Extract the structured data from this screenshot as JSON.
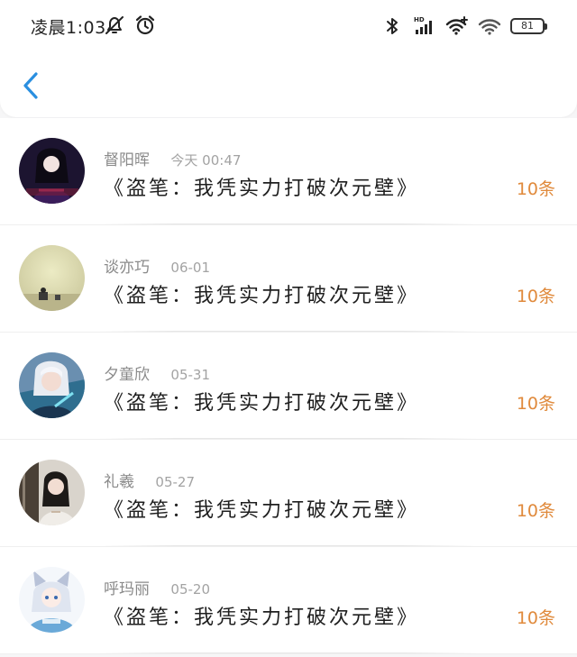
{
  "status_bar": {
    "time": "凌晨1:03",
    "battery": "81",
    "icons": [
      "alarm-off-icon",
      "alarm-clock-icon",
      "bluetooth-icon",
      "hd-signal-icon",
      "wifi-plus-icon",
      "wifi-icon",
      "battery-icon"
    ]
  },
  "nav": {
    "back_icon": "chevron-left-icon"
  },
  "colors": {
    "accent_blue": "#2a8fe0",
    "count_orange": "#e08a3c",
    "name_gray": "#8a8a8a"
  },
  "items": [
    {
      "name": "督阳晖",
      "date": "今天 00:47",
      "title": "《盗笔：我凭实力打破次元壁》",
      "count": "10条",
      "avatar": "avatar-dark-portrait"
    },
    {
      "name": "谈亦巧",
      "date": "06-01",
      "title": "《盗笔：我凭实力打破次元壁》",
      "count": "10条",
      "avatar": "avatar-beige-room"
    },
    {
      "name": "夕童欣",
      "date": "05-31",
      "title": "《盗笔：我凭实力打破次元壁》",
      "count": "10条",
      "avatar": "avatar-anime-white-hair"
    },
    {
      "name": "礼羲",
      "date": "05-27",
      "title": "《盗笔：我凭实力打破次元壁》",
      "count": "10条",
      "avatar": "avatar-girl-portrait"
    },
    {
      "name": "呼玛丽",
      "date": "05-20",
      "title": "《盗笔：我凭实力打破次元壁》",
      "count": "10条",
      "avatar": "avatar-anime-cat-ears"
    }
  ]
}
